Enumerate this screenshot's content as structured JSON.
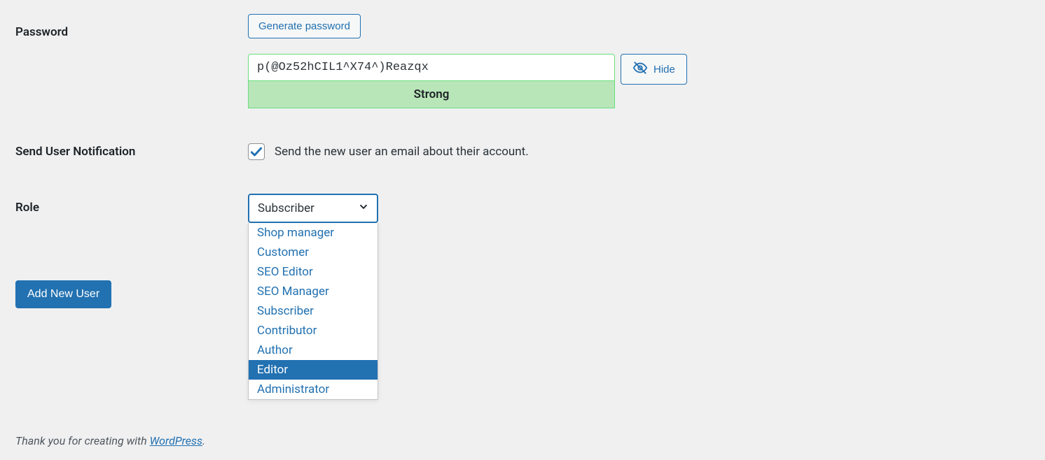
{
  "password": {
    "label": "Password",
    "generate_btn": "Generate password",
    "value": "p(@Oz52hCIL1^X74^)Reazqx",
    "strength_text": "Strong",
    "hide_btn": "Hide"
  },
  "notification": {
    "label": "Send User Notification",
    "checked": true,
    "description": "Send the new user an email about their account."
  },
  "role": {
    "label": "Role",
    "selected": "Subscriber",
    "options": [
      "Shop manager",
      "Customer",
      "SEO Editor",
      "SEO Manager",
      "Subscriber",
      "Contributor",
      "Author",
      "Editor",
      "Administrator"
    ],
    "highlighted": "Editor"
  },
  "submit": {
    "label": "Add New User"
  },
  "footer": {
    "prefix": "Thank you for creating with ",
    "link_text": "WordPress",
    "suffix": "."
  }
}
